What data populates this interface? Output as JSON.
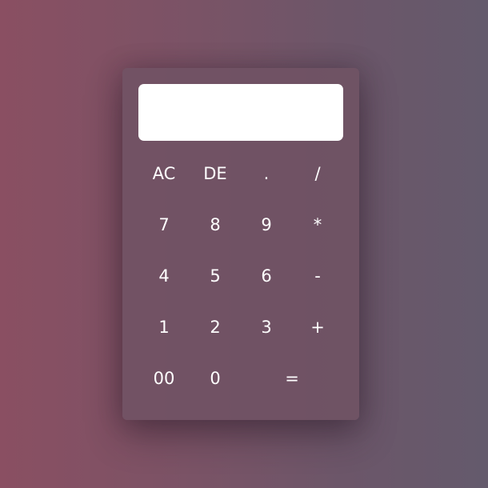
{
  "display": {
    "value": ""
  },
  "keys": {
    "ac": "AC",
    "de": "DE",
    "dot": ".",
    "divide": "/",
    "seven": "7",
    "eight": "8",
    "nine": "9",
    "multiply": "*",
    "four": "4",
    "five": "5",
    "six": "6",
    "minus": "-",
    "one": "1",
    "two": "2",
    "three": "3",
    "plus": "+",
    "double_zero": "00",
    "zero": "0",
    "equals": "="
  },
  "colors": {
    "background_left": "#8a4f62",
    "background_right": "#645a6c",
    "panel": "#705264",
    "display": "#ffffff",
    "key_text": "#ffffff"
  }
}
